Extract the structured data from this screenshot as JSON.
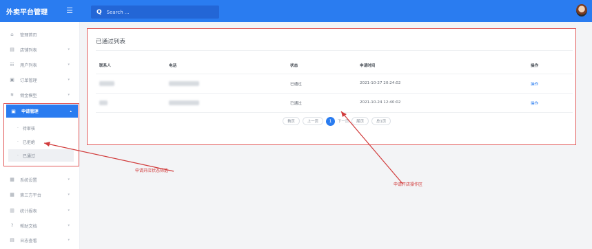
{
  "app": {
    "title": "外卖平台管理",
    "menu_icon": "hamburger-icon"
  },
  "search": {
    "placeholder": "Search ..."
  },
  "sidebar": {
    "items": [
      {
        "label": "管理首页",
        "icon": "home-icon",
        "glyph": "⌂",
        "arrow": ""
      },
      {
        "label": "店铺列表",
        "icon": "store-icon",
        "glyph": "▤",
        "arrow": "▾"
      },
      {
        "label": "用户列表",
        "icon": "users-icon",
        "glyph": "☷",
        "arrow": "▾"
      },
      {
        "label": "订单管理",
        "icon": "order-icon",
        "glyph": "▣",
        "arrow": "▾"
      },
      {
        "label": "佣金模型",
        "icon": "yen-icon",
        "glyph": "¥",
        "arrow": "▾"
      },
      {
        "label": "申请管理",
        "icon": "apply-icon",
        "glyph": "▣",
        "arrow": "▴"
      }
    ],
    "sub_items": [
      {
        "label": "待审核"
      },
      {
        "label": "已拒绝"
      },
      {
        "label": "已通过"
      }
    ],
    "lower_items": [
      {
        "label": "系统设置",
        "icon": "settings-grid-icon",
        "glyph": "▦",
        "arrow": "▾"
      },
      {
        "label": "第三方平台",
        "icon": "thirdparty-icon",
        "glyph": "▦",
        "arrow": "▾"
      },
      {
        "label": "统计报表",
        "icon": "bar-chart-icon",
        "glyph": "▥",
        "arrow": "▾"
      },
      {
        "label": "帮助文档",
        "icon": "help-icon",
        "glyph": "?",
        "arrow": "▾"
      },
      {
        "label": "日志查看",
        "icon": "log-icon",
        "glyph": "▤",
        "arrow": "▾"
      }
    ]
  },
  "card": {
    "title": "已通过列表",
    "headers": [
      "联系人",
      "电话",
      "状态",
      "申请时间",
      "操作"
    ],
    "rows": [
      {
        "status": "已通过",
        "time": "2021-10-27 20:24:02",
        "action": "操作"
      },
      {
        "status": "已通过",
        "time": "2021-10-24 12:40:02",
        "action": "操作"
      }
    ]
  },
  "pager": {
    "first": "首页",
    "prev": "上一页",
    "current": "1",
    "next": "下一页",
    "last": "尾页",
    "total": "总1页"
  },
  "annotations": {
    "left": "申请开店状态筛选",
    "right": "申请开店操作区"
  },
  "colors": {
    "primary": "#2a7cf0",
    "annotation": "#d13c3c"
  }
}
